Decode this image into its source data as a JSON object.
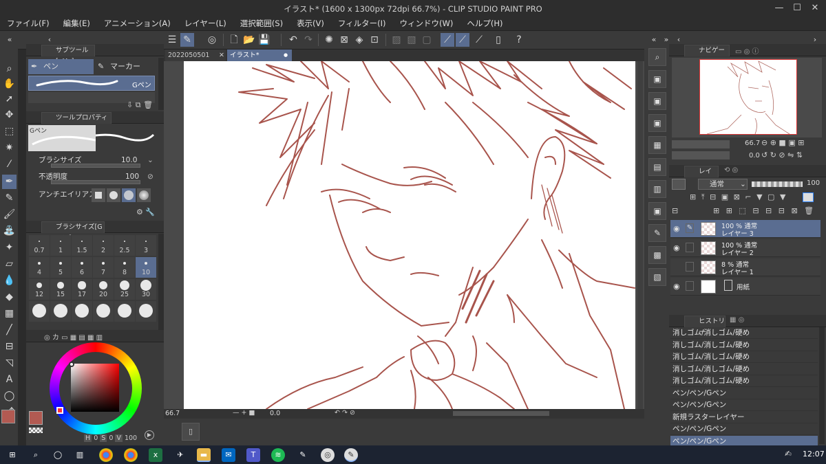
{
  "window": {
    "title": "イラスト* (1600 x 1300px 72dpi 66.7%) - CLIP STUDIO PAINT PRO",
    "minimize": "—",
    "maximize": "☐",
    "close": "✕"
  },
  "menu": [
    "ファイル(F)",
    "編集(E)",
    "アニメーション(A)",
    "レイヤー(L)",
    "選択範囲(S)",
    "表示(V)",
    "フィルター(I)",
    "ウィンドウ(W)",
    "ヘルプ(H)"
  ],
  "sub_tool_panel": {
    "tab": "サブツール[ペン]",
    "tabs": [
      "ペン",
      "マーカー"
    ],
    "selected_brush": "Gペン"
  },
  "tool_property": {
    "tab": "ツールプロパティ[Gペン]",
    "preview_label": "Gペン",
    "brush_size_label": "ブラシサイズ",
    "brush_size_value": "10.0",
    "opacity_label": "不透明度",
    "opacity_value": "100",
    "antialias_label": "アンチエイリアス"
  },
  "brush_size_panel": {
    "tab": "ブラシサイズ[Gペン]",
    "sizes": [
      "0.7",
      "1",
      "1.5",
      "2",
      "2.5",
      "3",
      "4",
      "5",
      "6",
      "7",
      "8",
      "10",
      "12",
      "15",
      "17",
      "20",
      "25",
      "30",
      "",
      "",
      "",
      "",
      "",
      ""
    ],
    "selected": "10"
  },
  "color_panel": {
    "h_label": "H",
    "h_value": "0",
    "s_label": "S",
    "s_value": "0",
    "v_label": "V",
    "v_value": "100",
    "main_color": "#b25a52",
    "sub_color": "#ffffff"
  },
  "document_tabs": [
    {
      "label": "2022050501",
      "close": "✕"
    },
    {
      "label": "イラスト*",
      "close": "●"
    }
  ],
  "canvas_status": {
    "zoom": "66.7",
    "rotation": "0.0"
  },
  "navigator": {
    "tab": "ナビゲーター",
    "zoom": "66.7",
    "rotation": "0.0"
  },
  "layer_panel": {
    "tab": "レイヤー",
    "blend_mode": "通常",
    "opacity": "100",
    "layers": [
      {
        "line1": "100 % 通常",
        "line2": "レイヤー 3",
        "selected": true
      },
      {
        "line1": "100 % 通常",
        "line2": "レイヤー 2",
        "selected": false
      },
      {
        "line1": "8 % 通常",
        "line2": "レイヤー 1",
        "selected": false
      },
      {
        "line1": "",
        "line2": "用紙",
        "selected": false
      }
    ]
  },
  "history_panel": {
    "tab": "ヒストリー",
    "entries": [
      "消しゴム/消しゴム/硬め",
      "消しゴム/消しゴム/硬め",
      "消しゴム/消しゴム/硬め",
      "消しゴム/消しゴム/硬め",
      "消しゴム/消しゴム/硬め",
      "ペン/ペン/Gペン",
      "ペン/ペン/Gペン",
      "新規ラスターレイヤー",
      "ペン/ペン/Gペン",
      "ペン/ペン/Gペン"
    ],
    "selected_index": 9
  },
  "taskbar": {
    "clock": "12:07"
  },
  "colors": {
    "accent": "#5a6d91",
    "line_art": "#a8544c"
  }
}
